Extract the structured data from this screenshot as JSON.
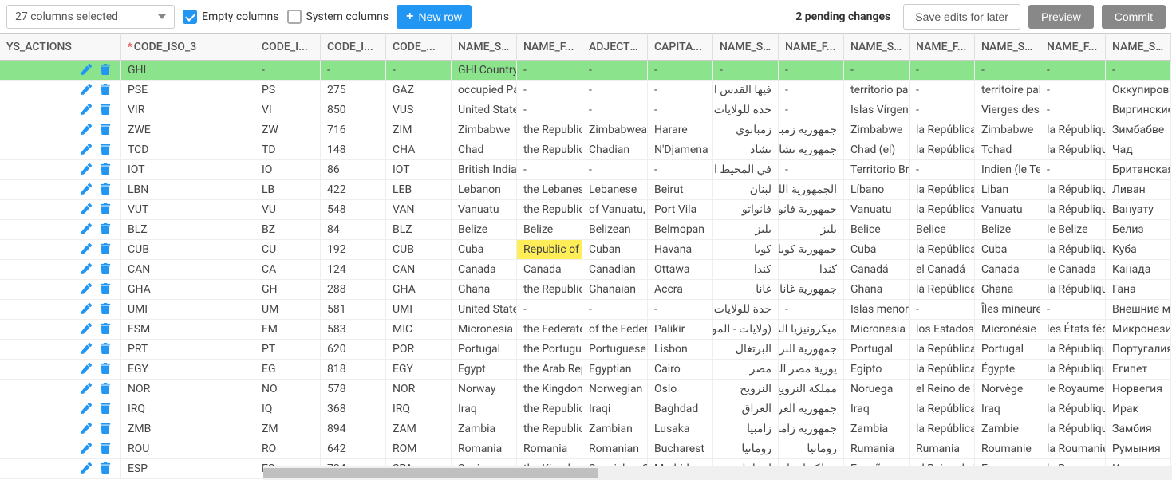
{
  "toolbar": {
    "columns_selected": "27 columns selected",
    "empty_cols_label": "Empty columns",
    "system_cols_label": "System columns",
    "new_row_label": "New row",
    "pending_changes": "2 pending changes",
    "save_edits": "Save edits for later",
    "preview": "Preview",
    "commit": "Commit"
  },
  "columns": [
    "YS_ACTIONS",
    "CODE_ISO_3",
    "CODE_I...",
    "CODE_I...",
    "CODE_...",
    "NAME_S...",
    "NAME_F...",
    "ADJECTI...",
    "CAPITA...",
    "NAME_S...",
    "NAME_F...",
    "NAME_S...",
    "NAME_F...",
    "NAME_S...",
    "NAME_F...",
    "NAME_S..."
  ],
  "key_col_index": 1,
  "rows": [
    {
      "new": true,
      "cells": [
        "GHI",
        "-",
        "-",
        "-",
        "GHI Country",
        "-",
        "-",
        "-",
        "-",
        "-",
        "-",
        "-",
        "-",
        "-",
        "-"
      ]
    },
    {
      "cells": [
        "PSE",
        "PS",
        "275",
        "GAZ",
        "occupied Pal",
        "-",
        "-",
        "-",
        "فيها القدس الشرقية",
        "-",
        "territorio pale",
        "-",
        "territoire pale",
        "-",
        "Оккупирова"
      ]
    },
    {
      "cells": [
        "VIR",
        "VI",
        "850",
        "VUS",
        "United States",
        "-",
        "-",
        "-",
        "حدة للولايات المتحدة",
        "-",
        "Islas Vírgene",
        "-",
        "Vierges des E",
        "-",
        "Виргинские"
      ]
    },
    {
      "cells": [
        "ZWE",
        "ZW",
        "716",
        "ZIM",
        "Zimbabwe",
        "the Republic",
        "Zimbabwean",
        "Harare",
        "زمبابوي",
        "جمهورية زمبابوي",
        "Zimbabwe",
        "la República c",
        "Zimbabwe",
        "la République",
        "Зимбабве"
      ]
    },
    {
      "cells": [
        "TCD",
        "TD",
        "148",
        "CHA",
        "Chad",
        "the Republic",
        "Chadian",
        "N'Djamena",
        "تشاد",
        "جمهورية تشاد",
        "Chad (el)",
        "la República c",
        "Tchad",
        "la République",
        "Чад"
      ]
    },
    {
      "cells": [
        "IOT",
        "IO",
        "86",
        "IOT",
        "British Indian",
        "-",
        "-",
        "-",
        "في المحيط الهندي",
        "-",
        "Territorio Brita",
        "-",
        "Indien (le Ter",
        "-",
        "Британская"
      ]
    },
    {
      "cells": [
        "LBN",
        "LB",
        "422",
        "LEB",
        "Lebanon",
        "the Lebanese",
        "Lebanese",
        "Beirut",
        "لبنان",
        "الجمهورية اللبنانية",
        "Líbano",
        "la República L",
        "Liban",
        "la République",
        "Ливан"
      ]
    },
    {
      "cells": [
        "VUT",
        "VU",
        "548",
        "VAN",
        "Vanuatu",
        "the Republic",
        "of Vanuatu, V",
        "Port Vila",
        "فانواتو",
        "جمهورية فانواتو",
        "Vanuatu",
        "la República c",
        "Vanuatu",
        "la République",
        "Вануату"
      ]
    },
    {
      "cells": [
        "BLZ",
        "BZ",
        "84",
        "BLZ",
        "Belize",
        "Belize",
        "Belizean",
        "Belmopan",
        "بليز",
        "بليز",
        "Belice",
        "Belice",
        "Belize",
        "le Belize",
        "Белиз"
      ]
    },
    {
      "cells": [
        "CUB",
        "CU",
        "192",
        "CUB",
        "Cuba",
        "Republic of C",
        "Cuban",
        "Havana",
        "كوبا",
        "جمهورية كوبا",
        "Cuba",
        "la República c",
        "Cuba",
        "la République",
        "Куба"
      ],
      "edited_col": 5
    },
    {
      "cells": [
        "CAN",
        "CA",
        "124",
        "CAN",
        "Canada",
        "Canada",
        "Canadian",
        "Ottawa",
        "كندا",
        "كندا",
        "Canadá",
        "el Canadá",
        "Canada",
        "le Canada",
        "Канада"
      ]
    },
    {
      "cells": [
        "GHA",
        "GH",
        "288",
        "GHA",
        "Ghana",
        "the Republic",
        "Ghanaian",
        "Accra",
        "غانا",
        "جمهورية غانا",
        "Ghana",
        "la República c",
        "Ghana",
        "la République",
        "Гана"
      ]
    },
    {
      "cells": [
        "UMI",
        "UM",
        "581",
        "UMI",
        "United States",
        "-",
        "-",
        "-",
        "حدة للولايات المتحدة",
        "-",
        "Islas menores",
        "-",
        "Îles mineures",
        "-",
        "Внешние ма"
      ]
    },
    {
      "cells": [
        "FSM",
        "FM",
        "583",
        "MIC",
        "Micronesia (F",
        "the Federated",
        "of the Federa",
        "Palikir",
        "(ولايات - الموحدة)",
        "ميكرونيزيا الموحدة",
        "Micronesia (E",
        "los Estados F",
        "Micronésie (É",
        "les États fédé",
        "Микронезия"
      ]
    },
    {
      "cells": [
        "PRT",
        "PT",
        "620",
        "POR",
        "Portugal",
        "the Portugues",
        "Portuguese",
        "Lisbon",
        "البرتغال",
        "جمهورية البرتغال",
        "Portugal",
        "la República F",
        "Portugal",
        "la République",
        "Португалия"
      ]
    },
    {
      "cells": [
        "EGY",
        "EG",
        "818",
        "EGY",
        "Egypt",
        "the Arab Rep",
        "Egyptian",
        "Cairo",
        "مصر",
        "يورية مصر العربية",
        "Egipto",
        "la República A",
        "Égypte",
        "la République",
        "Египет"
      ]
    },
    {
      "cells": [
        "NOR",
        "NO",
        "578",
        "NOR",
        "Norway",
        "the Kingdom",
        "Norwegian",
        "Oslo",
        "النرويج",
        "مملكة النرويج",
        "Noruega",
        "el Reino de N",
        "Norvège",
        "le Royaume d",
        "Норвегия"
      ]
    },
    {
      "cells": [
        "IRQ",
        "IQ",
        "368",
        "IRQ",
        "Iraq",
        "the Republic",
        "Iraqi",
        "Baghdad",
        "العراق",
        "جمهورية العراق",
        "Iraq",
        "la República c",
        "Iraq",
        "la République",
        "Ирак"
      ]
    },
    {
      "cells": [
        "ZMB",
        "ZM",
        "894",
        "ZAM",
        "Zambia",
        "the Republic",
        "Zambian",
        "Lusaka",
        "زامبيا",
        "جمهورية زامبيا",
        "Zambia",
        "la República c",
        "Zambie",
        "la République",
        "Замбия"
      ]
    },
    {
      "cells": [
        "ROU",
        "RO",
        "642",
        "ROM",
        "Romania",
        "Romania",
        "Romanian",
        "Bucharest",
        "رومانيا",
        "رومانيا",
        "Rumania",
        "Rumania",
        "Roumanie",
        "la Roumanie",
        "Румыния"
      ]
    },
    {
      "cells": [
        "ESP",
        "ES",
        "724",
        "SPA",
        "Spain",
        "the Kingdom",
        "Spanish, a Sp",
        "Madrid",
        "إسبانيا",
        "مملكة إسبانيا",
        "España",
        "el Reino de E",
        "Espagne",
        "le Royaume d",
        "Испания"
      ]
    }
  ]
}
